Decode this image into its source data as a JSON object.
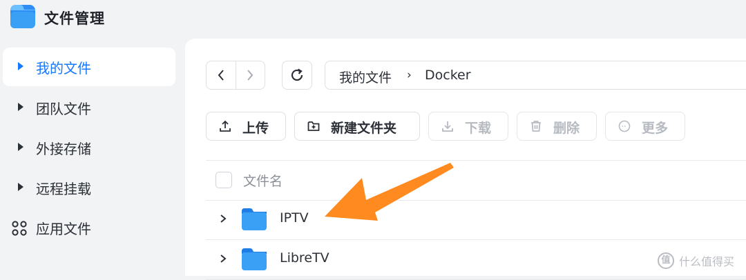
{
  "app": {
    "title": "文件管理",
    "icon": "folder-app-icon"
  },
  "sidebar": {
    "items": [
      {
        "label": "我的文件",
        "icon": "triangle-right-icon",
        "active": true
      },
      {
        "label": "团队文件",
        "icon": "triangle-right-icon",
        "active": false
      },
      {
        "label": "外接存储",
        "icon": "triangle-right-icon",
        "active": false
      },
      {
        "label": "远程挂载",
        "icon": "triangle-right-icon",
        "active": false
      },
      {
        "label": "应用文件",
        "icon": "apps-grid-icon",
        "active": false
      }
    ]
  },
  "navigation": {
    "back_icon": "chevron-left-icon",
    "forward_icon": "chevron-right-icon",
    "refresh_icon": "refresh-icon"
  },
  "breadcrumb": {
    "root": "我的文件",
    "separator": "›",
    "current": "Docker"
  },
  "toolbar": {
    "upload": {
      "label": "上传",
      "icon": "upload-icon",
      "enabled": true
    },
    "new_folder": {
      "label": "新建文件夹",
      "icon": "folder-plus-icon",
      "enabled": true
    },
    "download": {
      "label": "下载",
      "icon": "download-icon",
      "enabled": false
    },
    "delete": {
      "label": "删除",
      "icon": "trash-icon",
      "enabled": false
    },
    "more": {
      "label": "更多",
      "icon": "more-circle-icon",
      "enabled": false
    }
  },
  "file_list": {
    "columns": [
      "文件名"
    ],
    "rows": [
      {
        "name": "IPTV",
        "type": "folder"
      },
      {
        "name": "LibreTV",
        "type": "folder"
      }
    ]
  },
  "annotation": {
    "arrow_color": "#ff8a1f",
    "points_to": "IPTV"
  },
  "watermark": {
    "mark": "值",
    "text": "什么值得买"
  },
  "colors": {
    "accent": "#1677ff",
    "folder": "#3aa0f5",
    "arrow": "#ff8a1f"
  }
}
